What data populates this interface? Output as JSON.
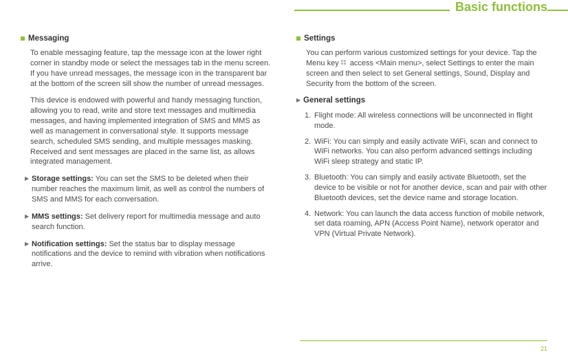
{
  "header": {
    "title": "Basic functions"
  },
  "page_number": "21",
  "left": {
    "messaging": {
      "title": "Messaging",
      "p1": "To enable messaging feature, tap the message icon at the lower right corner in standby mode or select the messages tab in the menu screen. If you have unread messages, the message icon in the transparent bar at the bottom of the screen sill show the number of unread messages.",
      "p2": "This device is endowed with powerful and handy messaging function, allowing you to read, write and store text messages and multimedia messages, and having implemented integration of SMS and MMS as well as management in conversational style. It supports message search, scheduled SMS sending, and multiple messages masking. Received and sent messages are placed in the same list, as allows integrated management.",
      "storage_label": "Storage settings:",
      "storage_text": " You can set the SMS to be deleted when their number reaches the maximum limit, as well as control the numbers of SMS and MMS for each conversation.",
      "mms_label": "MMS settings:",
      "mms_text": " Set delivery report for multimedia message and auto search function.",
      "notif_label": "Notification settings:",
      "notif_text": " Set the status bar to display message notifications and the device to remind with vibration when notifications arrive."
    }
  },
  "right": {
    "settings": {
      "title": "Settings",
      "p1a": "You can perform various customized settings for your device. Tap the Menu key ",
      "p1b": " access <Main menu>, select Settings to enter the main screen and then select to set General settings, Sound, Display and Security from the bottom of the screen."
    },
    "general": {
      "title": "General settings",
      "items": [
        {
          "n": "1.",
          "text": "Flight mode: All wireless connections will be unconnected in flight mode."
        },
        {
          "n": "2.",
          "text": "WiFi: You can simply and easily activate WiFi, scan and connect to WiFi networks. You can also perform advanced settings including WiFi sleep strategy and static IP."
        },
        {
          "n": "3.",
          "text": "Bluetooth: You can simply and easily activate Bluetooth, set the device to be visible or not for another device, scan and pair with other Bluetooth devices, set the device name and storage location."
        },
        {
          "n": "4.",
          "text": "Network: You can launch the data access function of mobile network, set data roaming, APN (Access Point Name), network operator and VPN (Virtual Private Network)."
        }
      ]
    }
  }
}
